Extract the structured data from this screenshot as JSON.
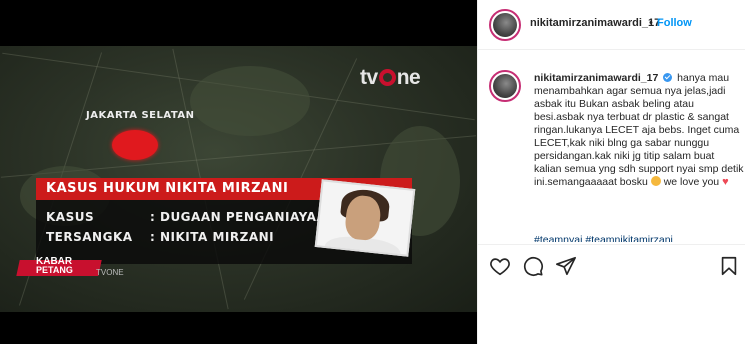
{
  "video": {
    "channel_logo": "tvone",
    "region_label": "JAKARTA SELATAN",
    "case_title": "KASUS HUKUM NIKITA MIRZANI",
    "rows": [
      {
        "label": "KASUS",
        "value": ": DUGAAN PENGANIAYAAN"
      },
      {
        "label": "TERSANGKA",
        "value": ": NIKITA MIRZANI"
      }
    ],
    "program_line1": "KABAR",
    "program_line2": "PETANG",
    "program_sub": "TVONE",
    "accent_color": "#cc1b1b"
  },
  "header": {
    "username": "nikitamirzanimawardi_17",
    "dot": "•",
    "follow_label": "Follow",
    "follow_color": "#0095f6"
  },
  "caption": {
    "username": "nikitamirzanimawardi_17",
    "text_part1": "hanya mau menambahkan agar semua nya jelas,jadi asbak itu Bukan asbak beling atau besi.asbak nya terbuat dr plastic & sangat ringan.lukanya LECET aja bebs. Inget cuma LECET,kak niki blng ga sabar nunggu persidangan.kak niki jg titip salam buat kalian semua yng sdh support nyai smp detik ini.semangaaaaat bosku",
    "text_part2": " we love you ",
    "hashtags": "#teamnyai #teamnikitamirzani"
  },
  "actions": {
    "like_icon": "heart-icon",
    "comment_icon": "comment-icon",
    "share_icon": "share-icon",
    "save_icon": "bookmark-icon"
  }
}
